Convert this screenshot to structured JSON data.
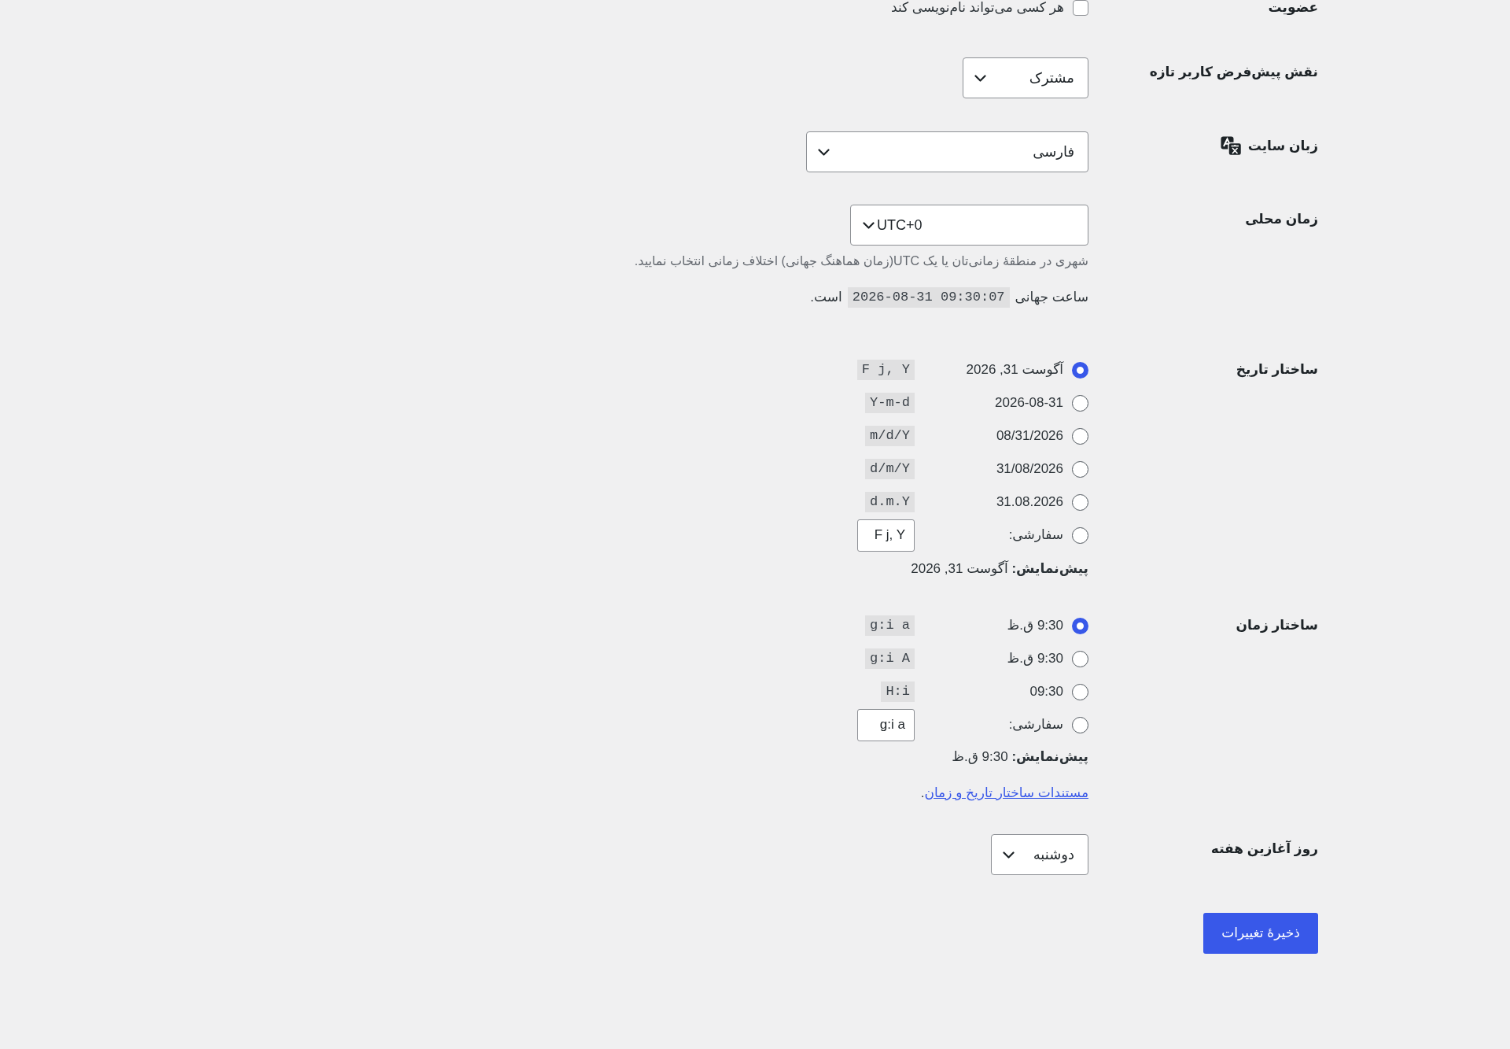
{
  "membership": {
    "label": "عضویت",
    "checkbox": {
      "label": "هر کسی می‌تواند نام‌نویسی کند",
      "checked": false
    }
  },
  "default_role": {
    "label": "نقش پیش‌فرض کاربر تازه",
    "value": "مشترک"
  },
  "site_language": {
    "label": "زبان سایت",
    "value": "فارسی"
  },
  "timezone": {
    "label": "زمان محلی",
    "value": "UTC+0",
    "description": "شهری در منطقهٔ زمانی‌تان یا یک UTC(زمان هماهنگ جهانی) اختلاف زمانی انتخاب نمایید.",
    "universal_time": {
      "prefix": "ساعت جهانی",
      "value": "2026-08-31 09:30:07",
      "suffix": "است."
    }
  },
  "date_format": {
    "label": "ساختار تاریخ",
    "options": [
      {
        "kind": "preset",
        "text": "آگوست 31, 2026",
        "code": "F j, Y",
        "selected": true
      },
      {
        "kind": "preset",
        "text": "2026-08-31",
        "code": "Y-m-d",
        "selected": false
      },
      {
        "kind": "preset",
        "text": "08/31/2026",
        "code": "m/d/Y",
        "selected": false
      },
      {
        "kind": "preset",
        "text": "31/08/2026",
        "code": "d/m/Y",
        "selected": false
      },
      {
        "kind": "preset",
        "text": "31.08.2026",
        "code": "d.m.Y",
        "selected": false
      },
      {
        "kind": "custom",
        "text": "سفارشی:",
        "value": "F j, Y",
        "selected": false
      }
    ],
    "preview": "**پیش‌نمایش:** آگوست 31, 2026"
  },
  "time_format": {
    "label": "ساختار زمان",
    "options": [
      {
        "kind": "preset",
        "text": "9:30 ق.ظ",
        "code": "g:i a",
        "selected": true
      },
      {
        "kind": "preset",
        "text": "9:30 ق.ظ",
        "code": "g:i A",
        "selected": false
      },
      {
        "kind": "preset",
        "text": "09:30",
        "code": "H:i",
        "selected": false
      },
      {
        "kind": "custom",
        "text": "سفارشی:",
        "value": "g:i a",
        "selected": false
      }
    ],
    "preview": "**پیش‌نمایش:** 9:30 ق.ظ",
    "documentation": {
      "link": "مستندات ساختار تاریخ و زمان",
      "suffix": "."
    }
  },
  "week_start": {
    "label": "روز آغازین هفته",
    "value": "دوشنبه"
  },
  "save_button": "ذخیرهٔ تغییرات"
}
